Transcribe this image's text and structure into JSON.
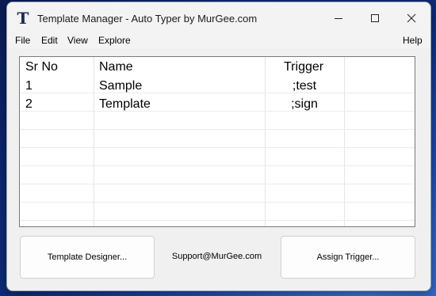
{
  "window": {
    "title": "Template Manager - Auto Typer by MurGee.com",
    "app_icon_letter": "T"
  },
  "menu": {
    "file": "File",
    "edit": "Edit",
    "view": "View",
    "explore": "Explore",
    "help": "Help"
  },
  "list": {
    "columns": [
      "Sr No",
      "Name",
      "Trigger",
      ""
    ],
    "rows": [
      {
        "sr": "1",
        "name": "Sample",
        "trigger": ";test"
      },
      {
        "sr": "2",
        "name": "Template",
        "trigger": ";sign"
      }
    ]
  },
  "buttons": {
    "template_designer": "Template Designer...",
    "assign_trigger": "Assign Trigger..."
  },
  "support_text": "Support@MurGee.com",
  "colors": {
    "window_bg": "#f0f0f0",
    "list_bg": "#ffffff",
    "desktop_accent": "#1f4fb8"
  }
}
